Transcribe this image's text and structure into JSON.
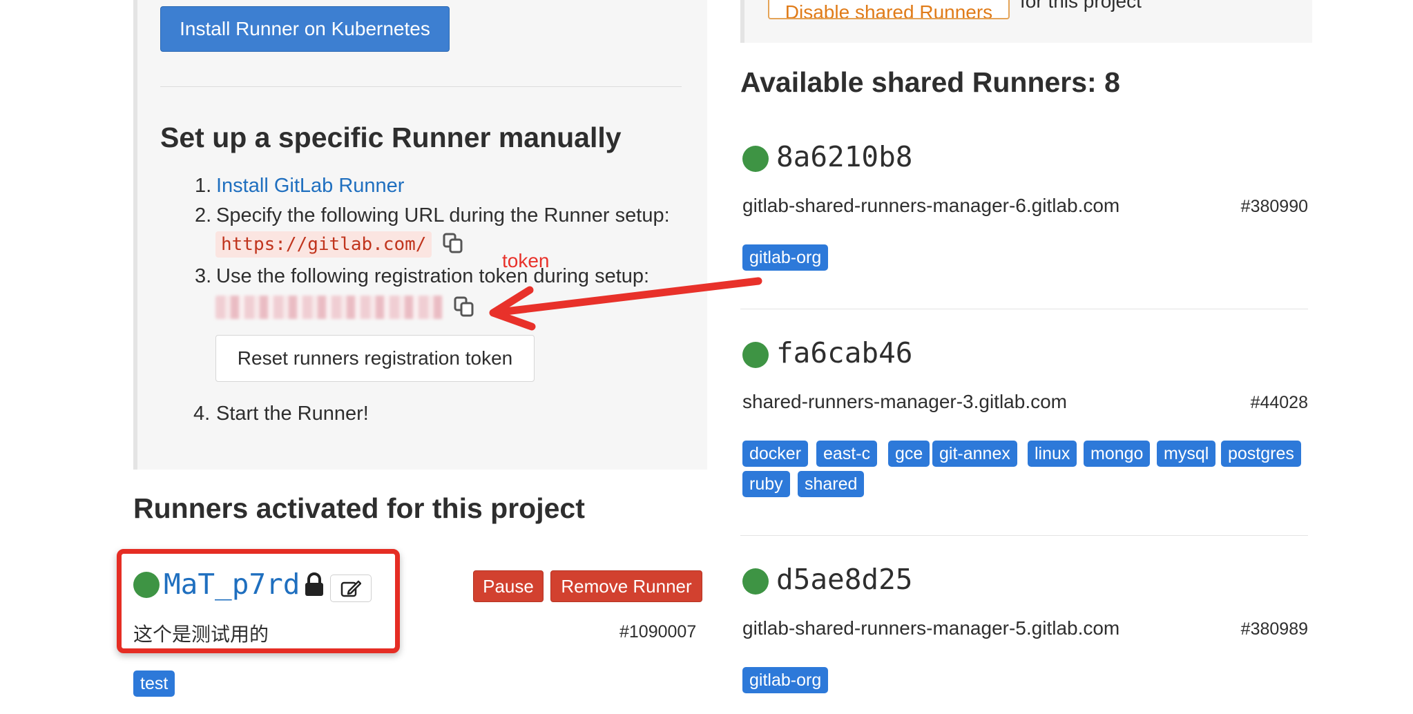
{
  "left": {
    "install_k8s_label": "Install Runner on Kubernetes",
    "setup_heading": "Set up a specific Runner manually",
    "steps": [
      {
        "num": "1.",
        "link": "Install GitLab Runner"
      },
      {
        "num": "2.",
        "text": "Specify the following URL during the Runner setup:"
      },
      {
        "num": "3.",
        "text": "Use the following registration token during setup:"
      },
      {
        "num": "4.",
        "text": "Start the Runner!"
      }
    ],
    "url": "https://gitlab.com/",
    "reset_token_label": "Reset runners registration token"
  },
  "annotation": {
    "label": "token",
    "color": "#e8312a"
  },
  "activated": {
    "heading": "Runners activated for this project",
    "runner": {
      "name": "MaT_p7rd",
      "description": "这个是测试用的",
      "id": "#1090007",
      "tags": [
        "test"
      ],
      "pause_label": "Pause",
      "remove_label": "Remove Runner"
    }
  },
  "right": {
    "disable_shared_label": "Disable shared Runners",
    "disable_shared_suffix": "for this project",
    "available_heading": "Available shared Runners: 8",
    "runners": [
      {
        "name": "8a6210b8",
        "host": "gitlab-shared-runners-manager-6.gitlab.com",
        "id": "#380990",
        "tags": [
          "gitlab-org"
        ]
      },
      {
        "name": "fa6cab46",
        "host": "shared-runners-manager-3.gitlab.com",
        "id": "#44028",
        "tags": [
          "docker",
          "east-c",
          "gce",
          "git-annex",
          "linux",
          "mongo",
          "mysql",
          "postgres",
          "ruby",
          "shared"
        ]
      },
      {
        "name": "d5ae8d25",
        "host": "gitlab-shared-runners-manager-5.gitlab.com",
        "id": "#380989",
        "tags": [
          "gitlab-org"
        ]
      }
    ]
  },
  "colors": {
    "primary_blue": "#3d7fd1",
    "tag_blue": "#2d79d9",
    "danger_red": "#d2412f",
    "status_green": "#3e9444",
    "link_blue": "#1f6fbf",
    "warning_orange": "#e07b18"
  },
  "icons": [
    "copy-icon",
    "lock-icon",
    "edit-icon",
    "status-online-icon",
    "arrow-annotation"
  ]
}
